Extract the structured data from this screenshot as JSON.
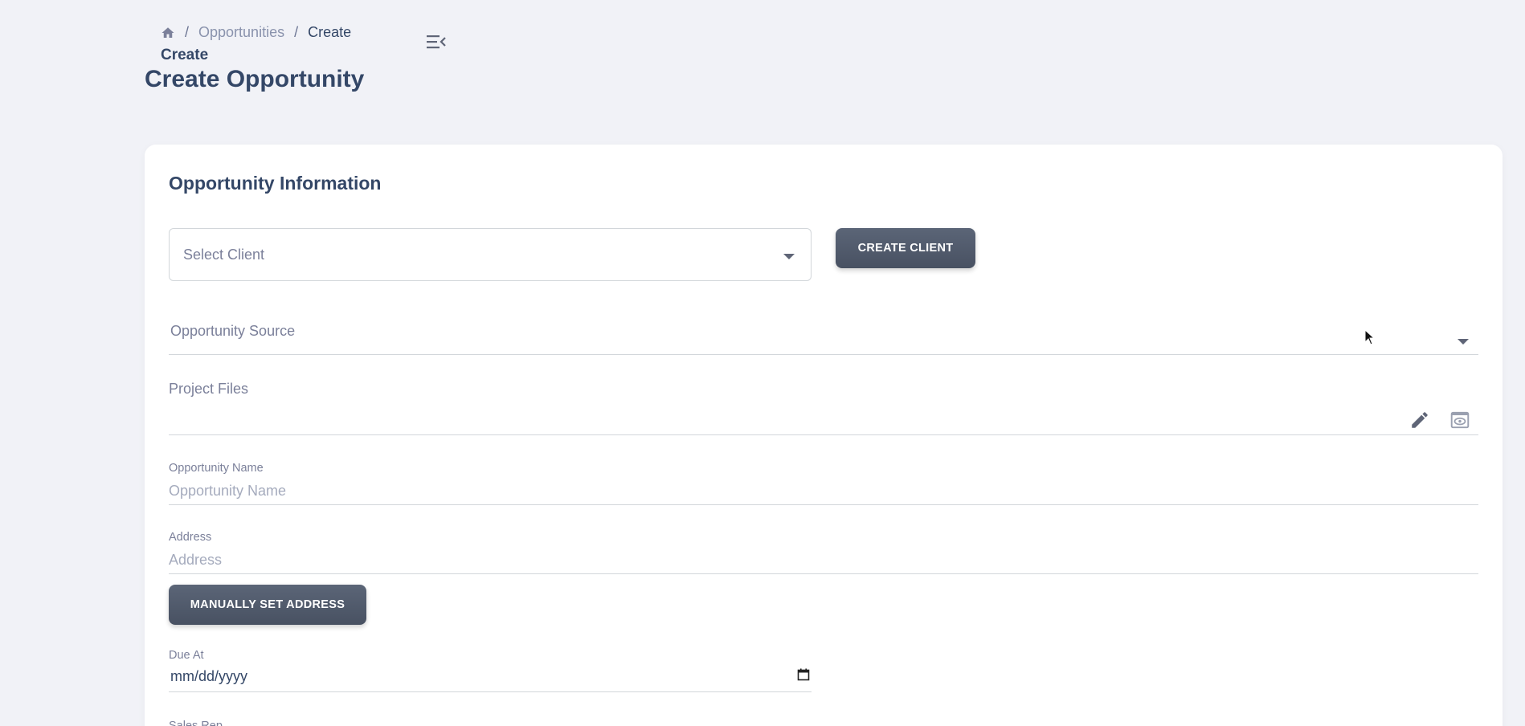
{
  "breadcrumb": {
    "home_icon": "home-icon",
    "separator": "/",
    "items": [
      "Opportunities",
      "Create"
    ]
  },
  "header": {
    "crumb_title": "Create",
    "page_title": "Create Opportunity",
    "menu_icon": "menu-collapse-icon"
  },
  "form": {
    "section_title": "Opportunity Information",
    "select_client_placeholder": "Select Client",
    "create_client_label": "CREATE CLIENT",
    "opportunity_source_label": "Opportunity Source",
    "project_files_label": "Project Files",
    "opportunity_name_label": "Opportunity Name",
    "opportunity_name_placeholder": "Opportunity Name",
    "address_label": "Address",
    "address_placeholder": "Address",
    "manual_address_label": "MANUALLY SET ADDRESS",
    "due_at_label": "Due At",
    "due_at_value": "mm/dd/yyyy",
    "next_label_partial": "Sales Rep"
  },
  "colors": {
    "background": "#f1f2f7",
    "card": "#ffffff",
    "primary_text": "#344767",
    "button": "#525b6c"
  }
}
